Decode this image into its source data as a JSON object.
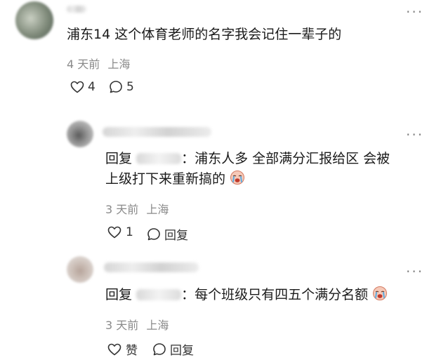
{
  "comments": [
    {
      "text": "浦东14 这个体育老师的名字我会记住一辈子的",
      "time": "4 天前",
      "location": "上海",
      "likes": "4",
      "replies": "5"
    }
  ],
  "replies": [
    {
      "prefix": "回复",
      "separator": "：",
      "line1": "浦东人多 全部满分汇报给区 会被",
      "line2": "上级打下来重新搞的",
      "emoji": "crying-face",
      "time": "3 天前",
      "location": "上海",
      "likes": "1",
      "reply_label": "回复"
    },
    {
      "prefix": "回复",
      "separator": "：",
      "line1": "每个班级只有四五个满分名额",
      "emoji": "crying-face",
      "time": "3 天前",
      "location": "上海",
      "like_label": "赞",
      "reply_label": "回复"
    }
  ],
  "icons": {
    "more": "more-icon",
    "like": "heart-icon",
    "comment": "comment-bubble-icon"
  }
}
